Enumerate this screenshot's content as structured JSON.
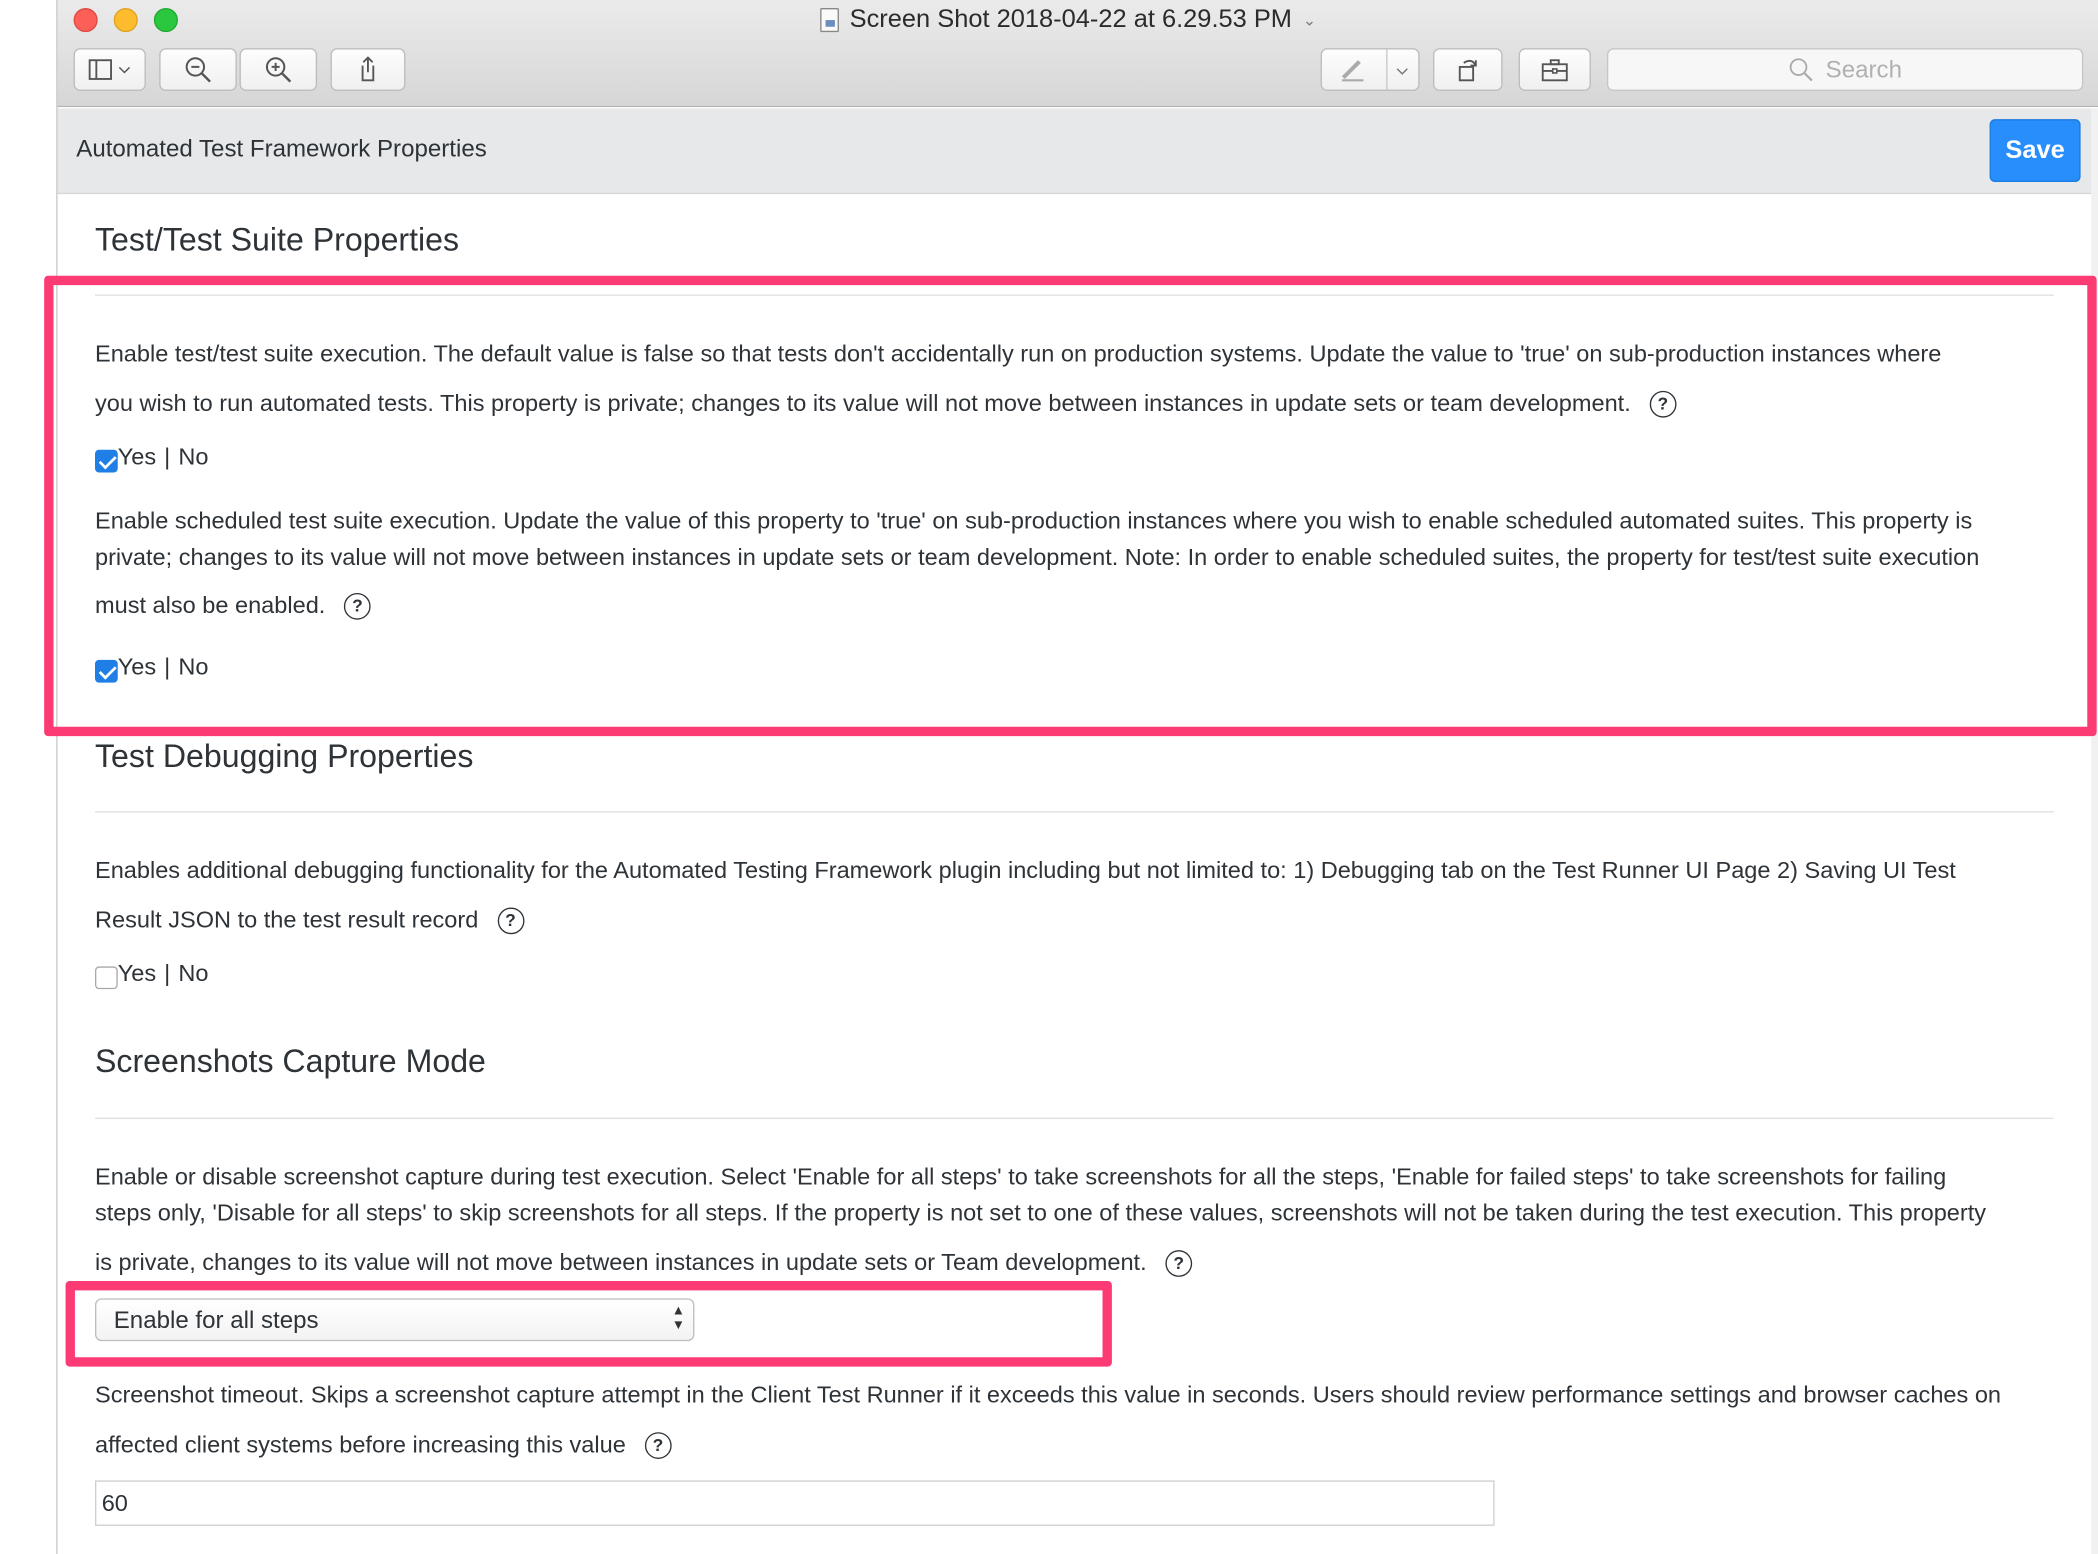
{
  "window": {
    "title": "Screen Shot 2018-04-22 at 6.29.53 PM",
    "search_placeholder": "Search"
  },
  "toolbar_icons": [
    "sidebar-icon",
    "zoom-out-icon",
    "zoom-in-icon",
    "share-icon",
    "markup-pen-icon",
    "rotate-icon",
    "toolbox-icon",
    "search-icon"
  ],
  "header": {
    "title": "Automated Test Framework Properties",
    "save_label": "Save"
  },
  "colors": {
    "highlight": "#fc3a74",
    "save_button": "#278efc"
  },
  "sections": {
    "suite": {
      "title": "Test/Test Suite Properties",
      "prop1_line1": "Enable test/test suite execution. The default value is false so that tests don't accidentally run on production systems. Update the value to 'true' on sub-production instances where",
      "prop1_line2": "you wish to run automated tests. This property is private; changes to its value will not move between instances in update sets or team development.",
      "prop1_checked": true,
      "prop2_line1": "Enable scheduled test suite execution. Update the value of this property to 'true' on sub-production instances where you wish to enable scheduled automated suites. This property is",
      "prop2_line2": "private; changes to its value will not move between instances in update sets or team development. Note: In order to enable scheduled suites, the property for test/test suite execution",
      "prop2_line3": "must also be enabled.",
      "prop2_checked": true
    },
    "debug": {
      "title": "Test Debugging Properties",
      "line1": "Enables additional debugging functionality for the Automated Testing Framework plugin including but not limited to: 1) Debugging tab on the Test Runner UI Page 2) Saving UI Test",
      "line2": "Result JSON to the test result record",
      "checked": false
    },
    "screenshots": {
      "title": "Screenshots Capture Mode",
      "line1": "Enable or disable screenshot capture during test execution. Select 'Enable for all steps' to take screenshots for all the steps, 'Enable for failed steps' to take screenshots for failing",
      "line2": "steps only, 'Disable for all steps' to skip screenshots for all steps. If the property is not set to one of these values, screenshots will not be taken during the test execution. This property",
      "line3": "is private, changes to its value will not move between instances in update sets or Team development.",
      "select_value": "Enable for all steps",
      "timeout_line1": "Screenshot timeout. Skips a screenshot capture attempt in the Client Test Runner if it exceeds this value in seconds. Users should review performance settings and browser caches on",
      "timeout_line2": "affected client systems before increasing this value",
      "timeout_value": "60"
    }
  },
  "yes_label": "Yes",
  "separator": "|",
  "no_label": "No",
  "help_glyph": "?"
}
